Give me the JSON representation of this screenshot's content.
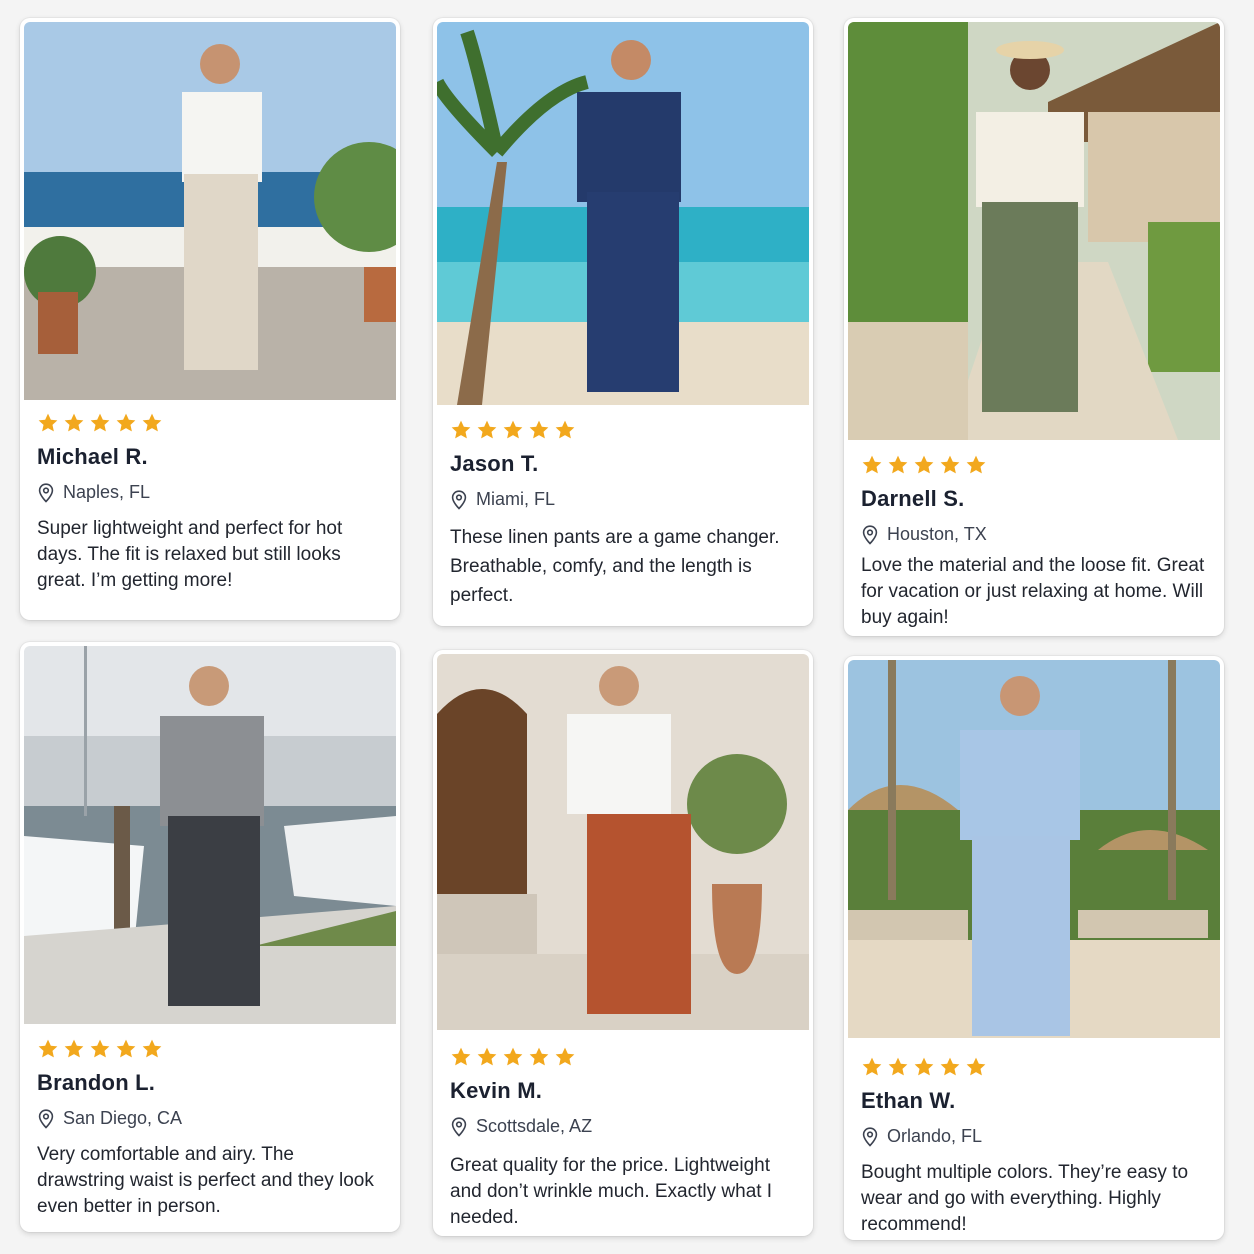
{
  "colors": {
    "star": "#f2a81d",
    "pin": "#3c4250",
    "card_bg": "#ffffff"
  },
  "reviews": [
    {
      "rating": 5,
      "name": "Michael R.",
      "location": "Naples, FL",
      "text": "Super lightweight and perfect for hot days. The fit is relaxed but still looks great. I’m getting more!",
      "photo": "man-white-shirt-beige-linen-pants-seaside-terrace"
    },
    {
      "rating": 5,
      "name": "Jason T.",
      "location": "Miami, FL",
      "text": "These linen pants are a game changer. Breathable, comfy, and the length is perfect.",
      "photo": "man-navy-linen-set-beach-palms"
    },
    {
      "rating": 5,
      "name": "Darnell S.",
      "location": "Houston, TX",
      "text": "Love the material and the loose fit. Great for vacation or just relaxing at home. Will buy again!",
      "photo": "man-straw-hat-olive-linen-pants-resort-path"
    },
    {
      "rating": 5,
      "name": "Brandon L.",
      "location": "San Diego, CA",
      "text": "Very comfortable and airy. The drawstring waist is perfect and they look even better in person.",
      "photo": "man-grey-tee-charcoal-linen-pants-marina"
    },
    {
      "rating": 5,
      "name": "Kevin M.",
      "location": "Scottsdale, AZ",
      "text": "Great quality for the price. Lightweight and don’t wrinkle much. Exactly what I needed.",
      "photo": "man-white-shirt-rust-linen-pants-courtyard"
    },
    {
      "rating": 5,
      "name": "Ethan W.",
      "location": "Orlando, FL",
      "text": "Bought multiple colors. They’re easy to wear and go with everything. Highly recommend!",
      "photo": "man-light-blue-linen-set-resort-beach"
    }
  ]
}
